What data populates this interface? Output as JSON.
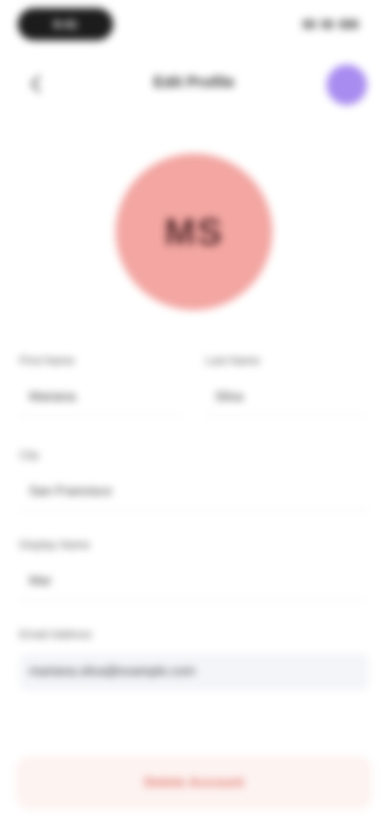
{
  "status_bar": {
    "time": "9:41"
  },
  "header": {
    "back_icon": "chevron-left-icon",
    "title": "Edit Profile"
  },
  "avatar": {
    "initials": "MS",
    "color": "#f3a6a2",
    "profile_color": "#a98cf0"
  },
  "form": {
    "first_name": {
      "label": "First Name",
      "value": "Mariana"
    },
    "last_name": {
      "label": "Last Name",
      "value": "Silva"
    },
    "city": {
      "label": "City",
      "value": "San Francisco"
    },
    "nickname": {
      "label": "Display Name",
      "value": "Mar"
    },
    "email": {
      "label": "Email Address",
      "value": "mariana.silva@example.com"
    }
  },
  "actions": {
    "delete_label": "Delete Account",
    "delete_color": "#e0766a"
  }
}
